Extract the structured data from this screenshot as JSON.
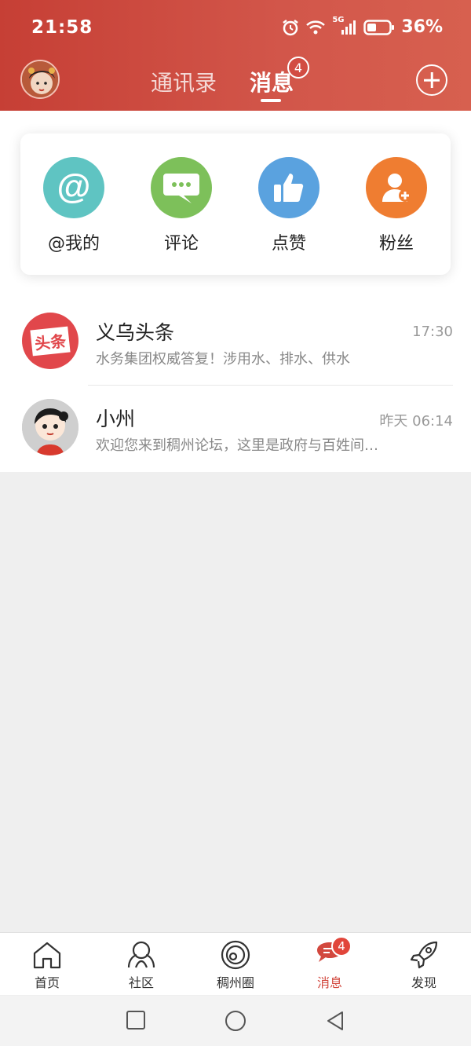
{
  "status_bar": {
    "time": "21:58",
    "network": "5G",
    "battery": "36%"
  },
  "header": {
    "tabs": [
      {
        "label": "通讯录",
        "active": false
      },
      {
        "label": "消息",
        "active": true,
        "badge": "4"
      }
    ],
    "add_icon": "plus-circle-icon",
    "accent_color": "#c63f35"
  },
  "quick_actions": [
    {
      "label": "@我的",
      "icon": "at-icon",
      "color": "#5fc4c2"
    },
    {
      "label": "评论",
      "icon": "comment-icon",
      "color": "#7dc05a"
    },
    {
      "label": "点赞",
      "icon": "thumbs-up-icon",
      "color": "#5aa2df"
    },
    {
      "label": "粉丝",
      "icon": "add-follower-icon",
      "color": "#ef7d31"
    }
  ],
  "messages": [
    {
      "name": "义乌头条",
      "preview": "水务集团权威答复！涉用水、排水、供水",
      "time": "17:30",
      "avatar_text": "头条"
    },
    {
      "name": "小州",
      "preview": "欢迎您来到稠州论坛，这里是政府与百姓间…",
      "time": "昨天 06:14"
    }
  ],
  "tab_bar": [
    {
      "label": "首页",
      "icon": "home-icon"
    },
    {
      "label": "社区",
      "icon": "community-icon"
    },
    {
      "label": "稠州圈",
      "icon": "circle-icon"
    },
    {
      "label": "消息",
      "icon": "message-icon",
      "active": true,
      "badge": "4"
    },
    {
      "label": "发现",
      "icon": "rocket-icon"
    }
  ]
}
